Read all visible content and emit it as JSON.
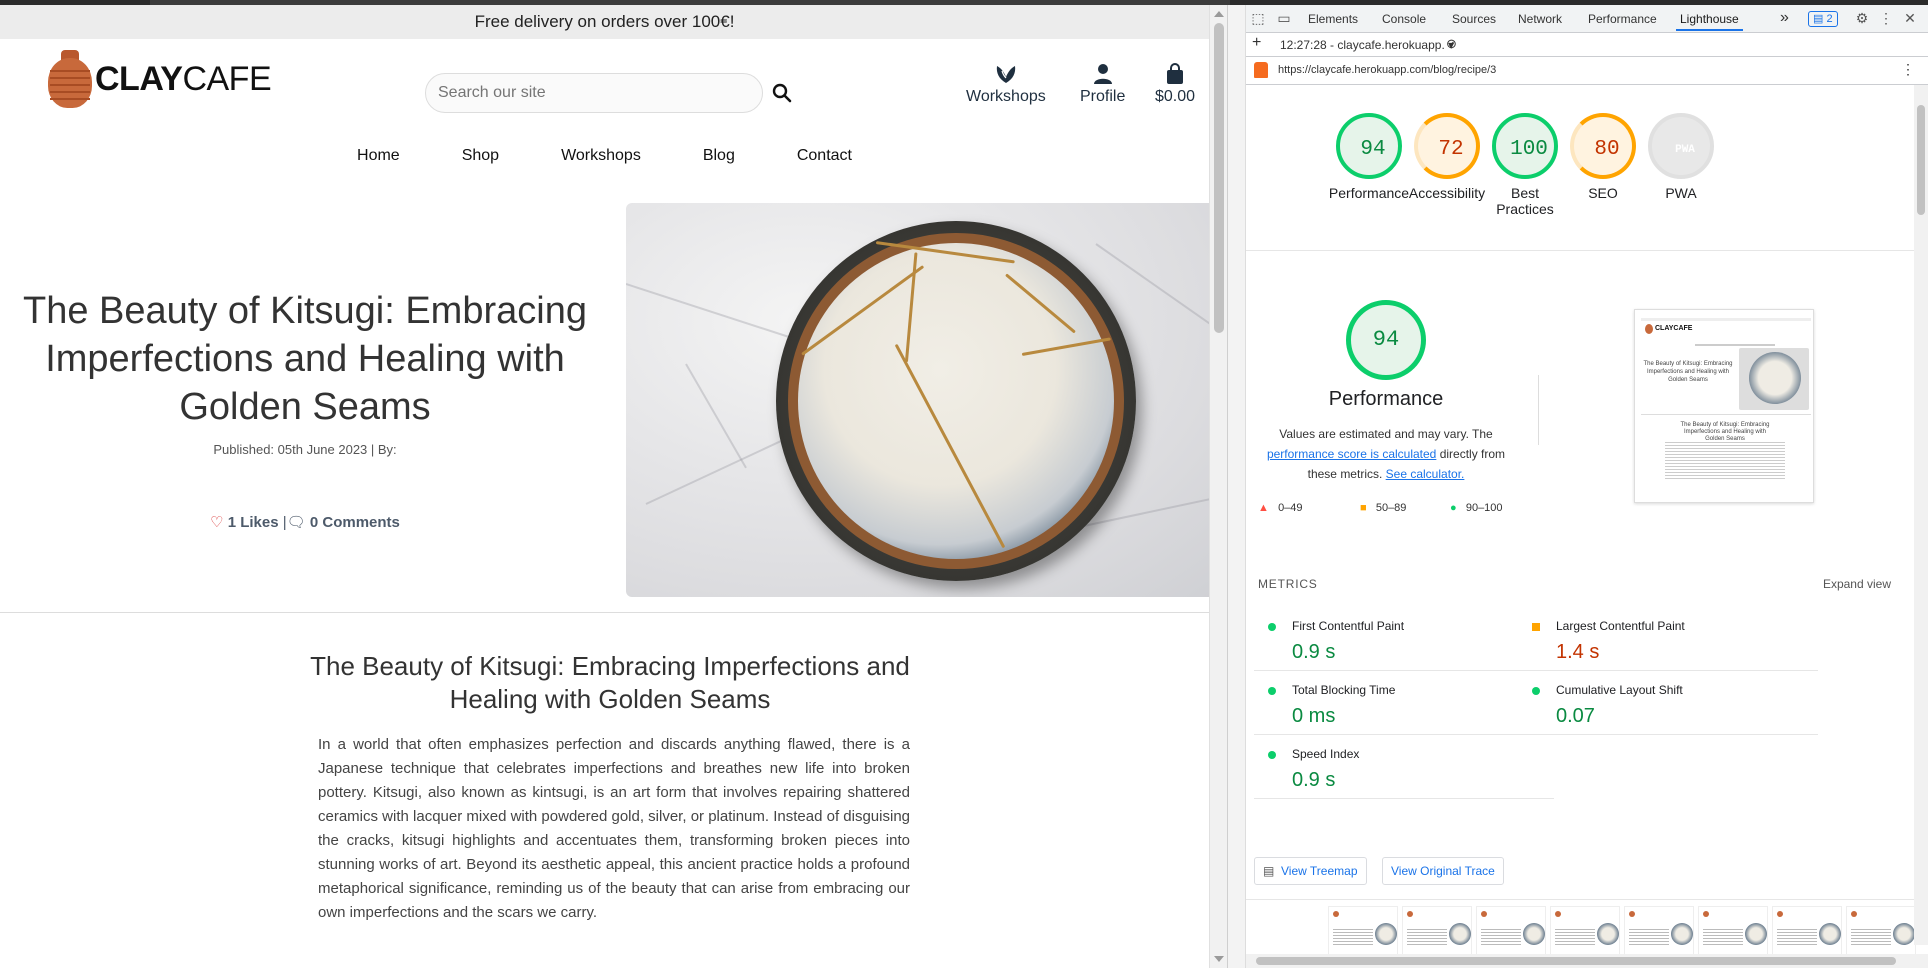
{
  "site": {
    "promo": "Free delivery on orders over 100€!",
    "logo": {
      "bold": "CLAY",
      "light": "CAFE"
    },
    "search": {
      "placeholder": "Search our site",
      "value": ""
    },
    "header_links": {
      "workshops": "Workshops",
      "profile": "Profile",
      "cart": "$0.00"
    },
    "nav": [
      "Home",
      "Shop",
      "Workshops",
      "Blog",
      "Contact"
    ],
    "hero": {
      "title": "The Beauty of Kitsugi: Embracing Imperfections and Healing with Golden Seams",
      "published": "Published: 05th June 2023 | By:",
      "likes": "1 Likes",
      "sep": "|",
      "comments": "0 Comments"
    },
    "article": {
      "title": "The Beauty of Kitsugi: Embracing Imperfections and Healing with Golden Seams",
      "paragraph": "In a world that often emphasizes perfection and discards anything flawed, there is a Japanese technique that celebrates imperfections and breathes new life into broken pottery. Kitsugi, also known as kintsugi, is an art form that involves repairing shattered ceramics with lacquer mixed with powdered gold, silver, or platinum. Instead of disguising the cracks, kitsugi highlights and accentuates them, transforming broken pieces into stunning works of art. Beyond its aesthetic appeal, this ancient practice holds a profound metaphorical significance, reminding us of the beauty that can arise from embracing our own imperfections and the scars we carry."
    }
  },
  "devtools": {
    "tabs": [
      "Elements",
      "Console",
      "Sources",
      "Network",
      "Performance",
      "Lighthouse"
    ],
    "active_tab": "Lighthouse",
    "more_tabs": "»",
    "issues_count": "2",
    "report_time": "12:27:28 - claycafe.herokuapp.",
    "url": "https://claycafe.herokuapp.com/blog/recipe/3",
    "scores": [
      {
        "label": "Performance",
        "value": "94",
        "level": "green"
      },
      {
        "label": "Accessibility",
        "value": "72",
        "level": "orange"
      },
      {
        "label": "Best Practices",
        "value": "100",
        "level": "green"
      },
      {
        "label": "SEO",
        "value": "80",
        "level": "orange"
      },
      {
        "label": "PWA",
        "value": "PWA",
        "level": "grey"
      }
    ],
    "performance": {
      "score": "94",
      "title": "Performance",
      "desc_before": "Values are estimated and may vary. The ",
      "desc_link1": "performance score is calculated",
      "desc_middle": " directly from these metrics. ",
      "desc_link2": "See calculator."
    },
    "legend": [
      {
        "range": "0–49",
        "color": "#ff4e42"
      },
      {
        "range": "50–89",
        "color": "#ffa400"
      },
      {
        "range": "90–100",
        "color": "#0cce6b"
      }
    ],
    "metrics_header": "METRICS",
    "expand_view": "Expand view",
    "metrics": [
      {
        "name": "First Contentful Paint",
        "value": "0.9 s",
        "level": "green"
      },
      {
        "name": "Largest Contentful Paint",
        "value": "1.4 s",
        "level": "orange"
      },
      {
        "name": "Total Blocking Time",
        "value": "0 ms",
        "level": "green"
      },
      {
        "name": "Cumulative Layout Shift",
        "value": "0.07",
        "level": "green"
      },
      {
        "name": "Speed Index",
        "value": "0.9 s",
        "level": "green"
      }
    ],
    "buttons": {
      "treemap": "View Treemap",
      "trace": "View Original Trace"
    }
  }
}
